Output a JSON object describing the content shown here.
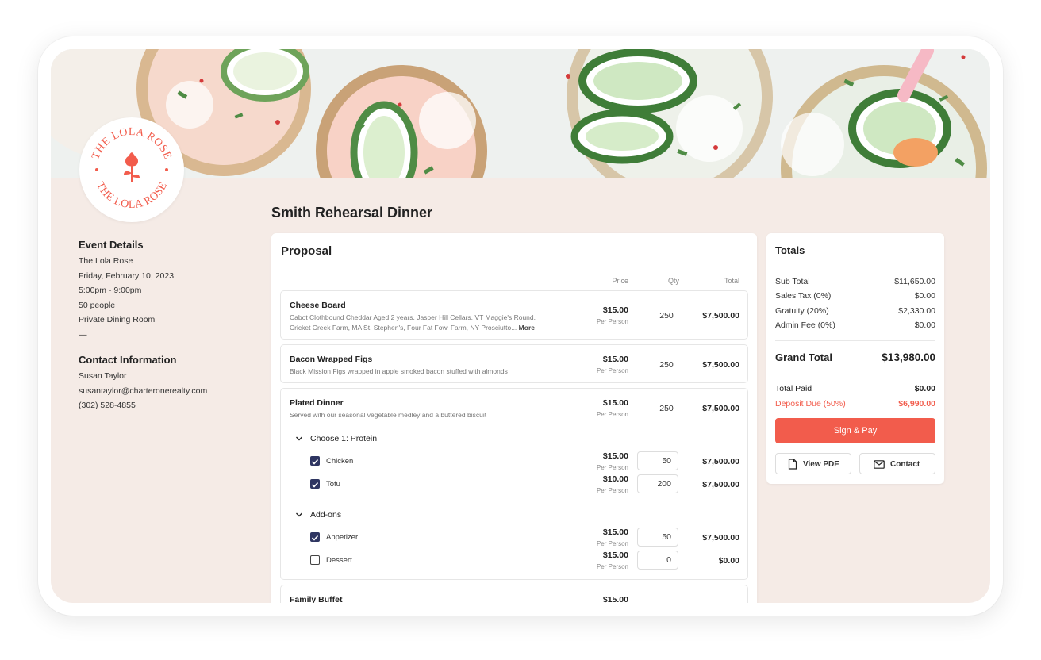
{
  "brand": {
    "name": "THE LOLA ROSE",
    "accent": "#f25c4c"
  },
  "page_title": "Smith Rehearsal Dinner",
  "event_details": {
    "heading": "Event Details",
    "venue": "The Lola Rose",
    "date": "Friday, February 10, 2023",
    "time": "5:00pm - 9:00pm",
    "guests": "50 people",
    "room": "Private Dining Room",
    "separator": "—"
  },
  "contact_info": {
    "heading": "Contact Information",
    "name": "Susan Taylor",
    "email": "susantaylor@charteronerealty.com",
    "phone": "(302) 528-4855"
  },
  "proposal": {
    "heading": "Proposal",
    "columns": {
      "price": "Price",
      "qty": "Qty",
      "total": "Total"
    },
    "items": [
      {
        "name": "Cheese Board",
        "desc_line1": "Cabot Clothbound Cheddar Aged 2 years, Jasper Hill Cellars, VT Maggie's Round,",
        "desc_line2": "Cricket Creek Farm, MA St. Stephen's, Four Fat Fowl Farm, NY Prosciutto...",
        "more": "More",
        "price": "$15.00",
        "per": "Per Person",
        "qty": "250",
        "total": "$7,500.00"
      },
      {
        "name": "Bacon Wrapped Figs",
        "desc": "Black Mission Figs wrapped in apple smoked bacon stuffed with almonds",
        "price": "$15.00",
        "per": "Per Person",
        "qty": "250",
        "total": "$7,500.00"
      },
      {
        "name": "Plated Dinner",
        "desc": "Served with our seasonal vegetable medley and a buttered biscuit",
        "price": "$15.00",
        "per": "Per Person",
        "qty": "250",
        "total": "$7,500.00",
        "groups": [
          {
            "label": "Choose 1: Protein",
            "options": [
              {
                "label": "Chicken",
                "checked": true,
                "price": "$15.00",
                "per": "Per Person",
                "qty": "50",
                "total": "$7,500.00"
              },
              {
                "label": "Tofu",
                "checked": true,
                "price": "$10.00",
                "per": "Per Person",
                "qty": "200",
                "total": "$7,500.00"
              }
            ]
          },
          {
            "label": "Add-ons",
            "options": [
              {
                "label": "Appetizer",
                "checked": true,
                "price": "$15.00",
                "per": "Per Person",
                "qty": "50",
                "total": "$7,500.00"
              },
              {
                "label": "Dessert",
                "checked": false,
                "price": "$15.00",
                "per": "Per Person",
                "qty": "0",
                "total": "$0.00"
              }
            ]
          }
        ]
      },
      {
        "name": "Family Buffet",
        "price": "$15.00"
      }
    ]
  },
  "totals": {
    "heading": "Totals",
    "sub_total_label": "Sub Total",
    "sub_total": "$11,650.00",
    "sales_tax_label": "Sales Tax (0%)",
    "sales_tax": "$0.00",
    "gratuity_label": "Gratuity (20%)",
    "gratuity": "$2,330.00",
    "admin_fee_label": "Admin Fee (0%)",
    "admin_fee": "$0.00",
    "grand_total_label": "Grand Total",
    "grand_total": "$13,980.00",
    "total_paid_label": "Total Paid",
    "total_paid": "$0.00",
    "deposit_label": "Deposit Due (50%)",
    "deposit": "$6,990.00",
    "sign_pay_label": "Sign & Pay",
    "view_pdf_label": "View PDF",
    "contact_label": "Contact"
  },
  "icons": [
    "rose-logo-icon",
    "chevron-down-icon",
    "checkbox-icon",
    "document-icon",
    "envelope-icon"
  ]
}
